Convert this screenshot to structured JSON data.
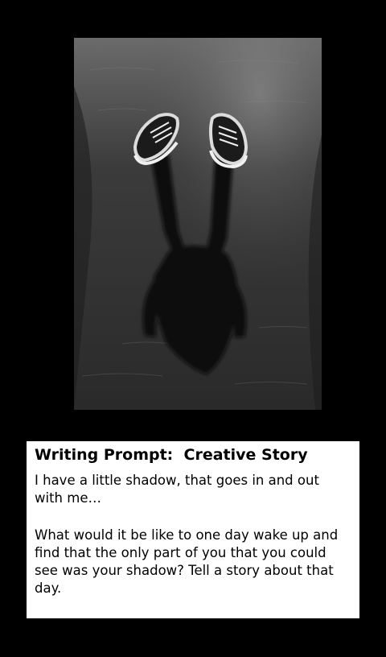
{
  "image": {
    "alt": "",
    "colors": {
      "frame": "#000000",
      "card": "#ffffff"
    }
  },
  "prompt": {
    "title": "Writing Prompt:  Creative Story",
    "line1": "I have a little shadow, that goes in and out with me…",
    "line2": "What would it be like to one day wake up and find that the only part of you that you could see was your shadow?  Tell a story about that day."
  }
}
